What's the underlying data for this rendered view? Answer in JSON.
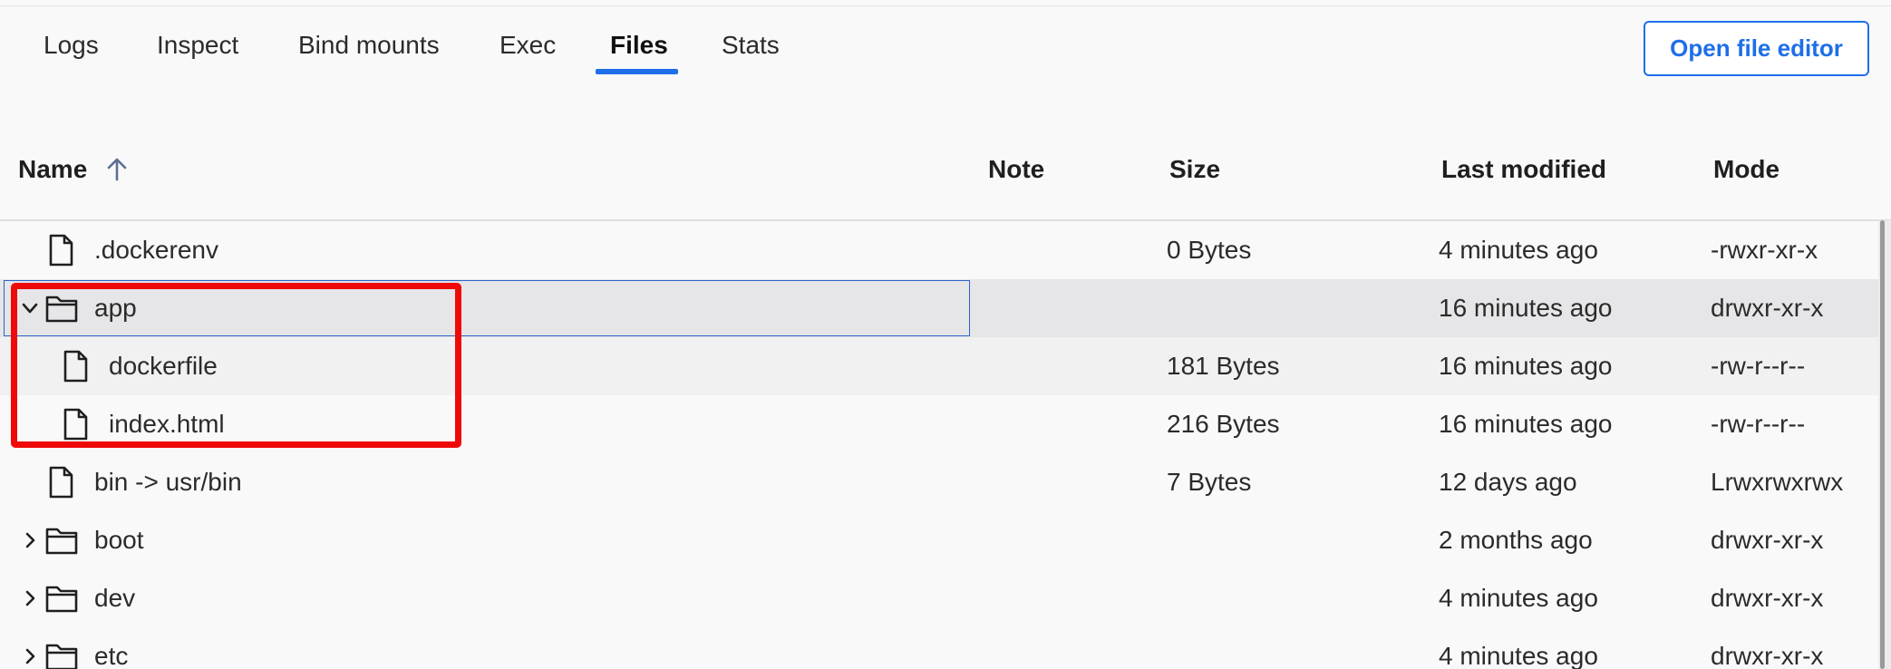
{
  "tabs": [
    {
      "label": "Logs",
      "active": false
    },
    {
      "label": "Inspect",
      "active": false
    },
    {
      "label": "Bind mounts",
      "active": false
    },
    {
      "label": "Exec",
      "active": false
    },
    {
      "label": "Files",
      "active": true
    },
    {
      "label": "Stats",
      "active": false
    }
  ],
  "toolbar": {
    "open_editor_label": "Open file editor"
  },
  "table": {
    "columns": {
      "name": "Name",
      "note": "Note",
      "size": "Size",
      "last_modified": "Last modified",
      "mode": "Mode"
    },
    "sort_icon": "arrow-up-icon",
    "rows": [
      {
        "name": ".dockerenv",
        "type": "file",
        "size": "0 Bytes",
        "modified": "4 minutes ago",
        "mode": "-rwxr-xr-x"
      },
      {
        "name": "app",
        "type": "folder",
        "expanded": true,
        "selected": true,
        "size": "",
        "modified": "16 minutes ago",
        "mode": "drwxr-xr-x"
      },
      {
        "name": "dockerfile",
        "type": "file",
        "indent": 1,
        "size": "181 Bytes",
        "modified": "16 minutes ago",
        "mode": "-rw-r--r--"
      },
      {
        "name": "index.html",
        "type": "file",
        "indent": 1,
        "size": "216 Bytes",
        "modified": "16 minutes ago",
        "mode": "-rw-r--r--"
      },
      {
        "name": "bin -> usr/bin",
        "type": "file",
        "size": "7 Bytes",
        "modified": "12 days ago",
        "mode": "Lrwxrwxrwx"
      },
      {
        "name": "boot",
        "type": "folder",
        "expanded": false,
        "size": "",
        "modified": "2 months ago",
        "mode": "drwxr-xr-x"
      },
      {
        "name": "dev",
        "type": "folder",
        "expanded": false,
        "size": "",
        "modified": "4 minutes ago",
        "mode": "drwxr-xr-x"
      },
      {
        "name": "etc",
        "type": "folder",
        "expanded": false,
        "size": "",
        "modified": "4 minutes ago",
        "mode": "drwxr-xr-x"
      }
    ]
  },
  "colors": {
    "accent": "#1e6fe8",
    "highlight": "#ef0a0a",
    "selected_row": "#e6e6e8"
  }
}
